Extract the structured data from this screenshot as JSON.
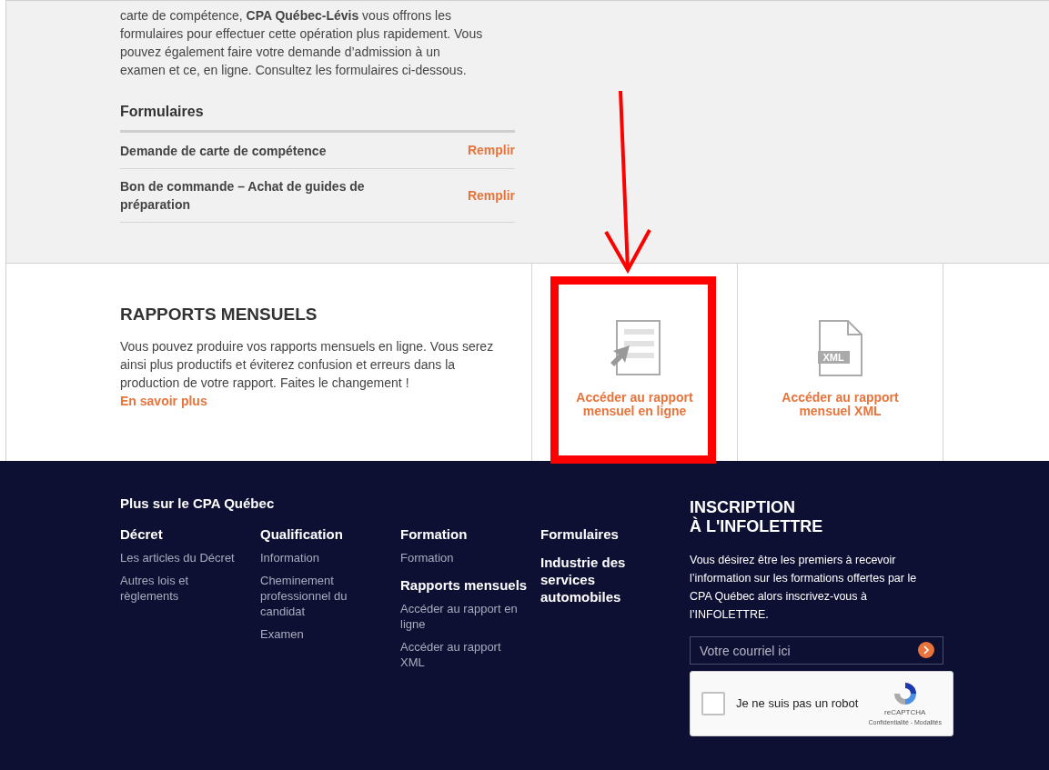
{
  "intro": {
    "paragraph": "carte de compétence, **CPA Québec-Lévis** vous offrons les formulaires pour effectuer cette opération plus rapidement. Vous pouvez également faire votre demande d’admission à un examen et ce, en ligne. Consultez les formulaires ci-dessous."
  },
  "forms": {
    "title": "Formulaires",
    "rows": [
      {
        "label": "Demande de carte de compétence",
        "action": "Remplir"
      },
      {
        "label": "Bon de commande – Achat de guides de préparation",
        "action": "Remplir"
      }
    ]
  },
  "reports": {
    "title": "RAPPORTS MENSUELS",
    "text": "Vous pouvez produire vos rapports mensuels en ligne. Vous serez ainsi plus productifs et éviterez confusion et erreurs dans la production de votre rapport. Faites le changement !",
    "link": "En savoir plus",
    "tiles": [
      {
        "kind": "online",
        "label": "Accéder au rapport mensuel en ligne",
        "highlighted": true
      },
      {
        "kind": "xml",
        "label": "Accéder au rapport mensuel XML",
        "badge": "XML",
        "highlighted": false
      }
    ]
  },
  "footer": {
    "title": "Plus sur le CPA Québec",
    "columns": [
      {
        "groups": [
          {
            "heading": "Décret",
            "links": [
              "Les articles du Décret",
              "Autres lois et règlements"
            ]
          }
        ]
      },
      {
        "groups": [
          {
            "heading": "Qualification",
            "links": [
              "Information",
              "Cheminement professionnel du candidat",
              "Examen"
            ]
          }
        ]
      },
      {
        "groups": [
          {
            "heading": "Formation",
            "links": [
              "Formation"
            ]
          },
          {
            "heading": "Rapports mensuels",
            "links": [
              "Accéder au rapport en ligne",
              "Accéder au rapport XML"
            ]
          }
        ]
      },
      {
        "groups": [
          {
            "heading": "Formulaires"
          },
          {
            "heading": "Industrie des services automobiles"
          }
        ]
      }
    ],
    "newsletter": {
      "title_lines": [
        "INSCRIPTION",
        "À L'INFOLETTRE"
      ],
      "text": "Vous désirez être les premiers à recevoir l’information sur les formations offertes par le CPA Québec alors inscrivez-vous à l’INFOLETTRE.",
      "placeholder": "Votre courriel ici",
      "captcha": {
        "label": "Je ne suis pas un robot",
        "checked": false,
        "brand": "reCAPTCHA",
        "terms": "Confidentialité - Modalités"
      }
    }
  }
}
